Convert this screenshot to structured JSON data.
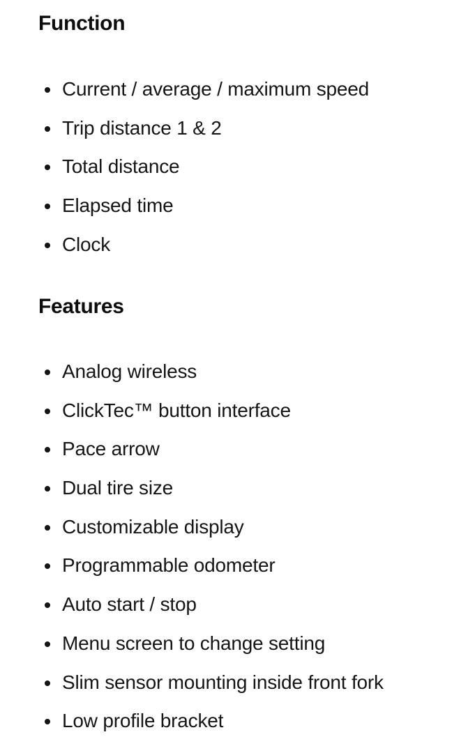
{
  "sections": [
    {
      "heading": "Function",
      "items": [
        "Current / average / maximum speed",
        "Trip distance 1 & 2",
        "Total distance",
        "Elapsed time",
        "Clock"
      ]
    },
    {
      "heading": "Features",
      "items": [
        "Analog wireless",
        "ClickTec™ button interface",
        "Pace arrow",
        "Dual tire size",
        "Customizable display",
        "Programmable odometer",
        "Auto start / stop",
        "Menu screen to change setting",
        "Slim sensor mounting inside front fork",
        "Low profile bracket"
      ]
    }
  ]
}
